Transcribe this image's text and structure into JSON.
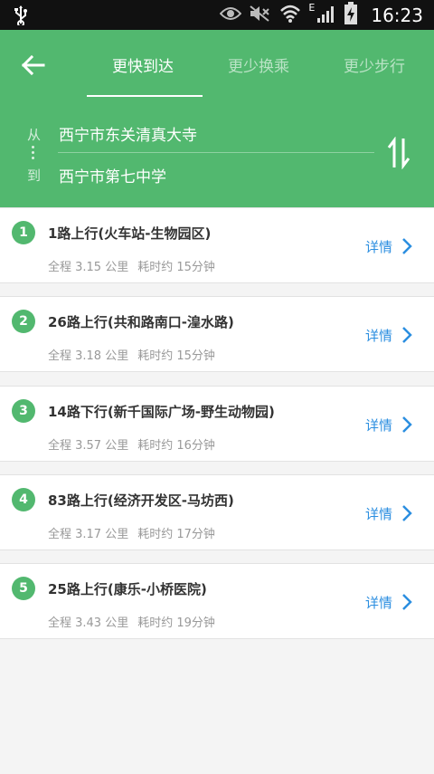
{
  "status_bar": {
    "time": "16:23",
    "network_type": "E",
    "icons": [
      "usb-icon",
      "eye-icon",
      "mute-icon",
      "wifi-icon",
      "signal-icon",
      "battery-charging-icon"
    ]
  },
  "header": {
    "tabs": [
      {
        "label": "更快到达",
        "active": true
      },
      {
        "label": "更少换乘",
        "active": false
      },
      {
        "label": "更少步行",
        "active": false
      }
    ],
    "from_label": "从",
    "to_label": "到",
    "from_value": "西宁市东关清真大寺",
    "to_value": "西宁市第七中学",
    "colors": {
      "primary": "#52b86f",
      "link": "#2b8ee0"
    }
  },
  "routes": [
    {
      "index": "1",
      "name": "1路上行(火车站-生物园区)",
      "distance": "全程 3.15 公里",
      "duration": "耗时约 15分钟",
      "detail_label": "详情"
    },
    {
      "index": "2",
      "name": "26路上行(共和路南口-湟水路)",
      "distance": "全程 3.18 公里",
      "duration": "耗时约 15分钟",
      "detail_label": "详情"
    },
    {
      "index": "3",
      "name": "14路下行(新千国际广场-野生动物园)",
      "distance": "全程 3.57 公里",
      "duration": "耗时约 16分钟",
      "detail_label": "详情"
    },
    {
      "index": "4",
      "name": "83路上行(经济开发区-马坊西)",
      "distance": "全程 3.17 公里",
      "duration": "耗时约 17分钟",
      "detail_label": "详情"
    },
    {
      "index": "5",
      "name": "25路上行(康乐-小桥医院)",
      "distance": "全程 3.43 公里",
      "duration": "耗时约 19分钟",
      "detail_label": "详情"
    }
  ]
}
